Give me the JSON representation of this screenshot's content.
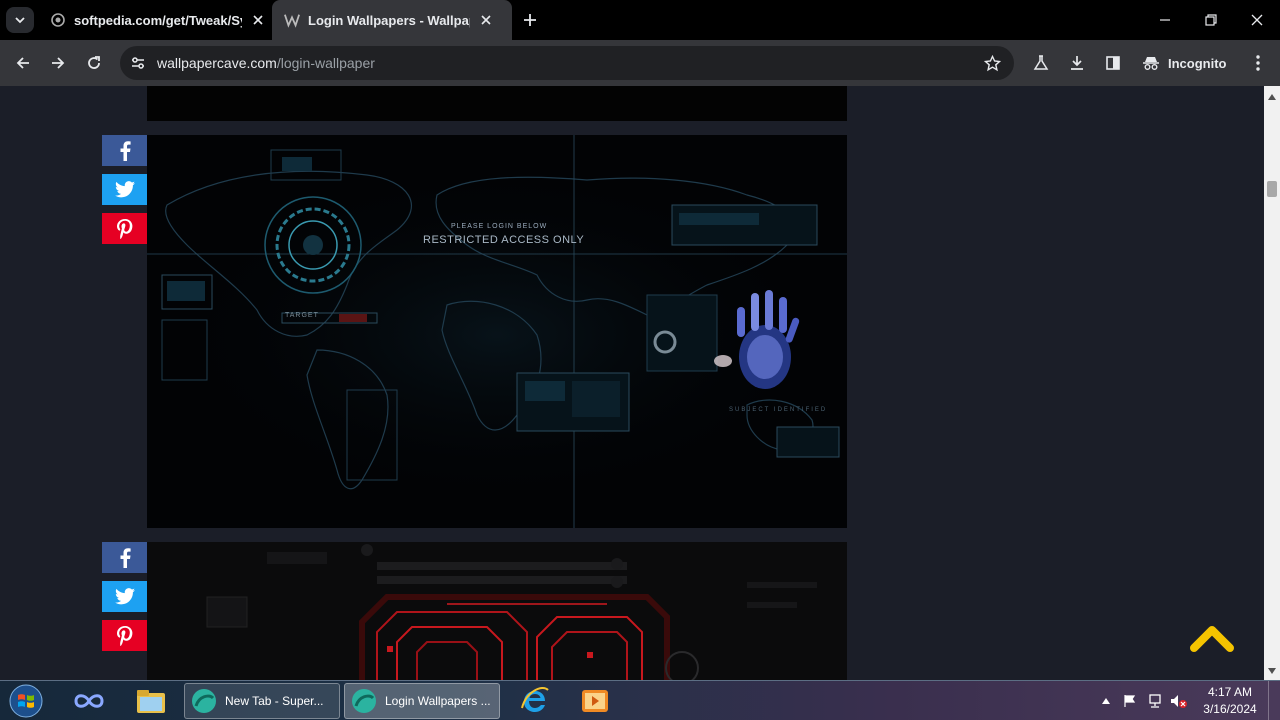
{
  "browser": {
    "tabs": [
      {
        "title": "softpedia.com/get/Tweak/Syst",
        "icon": "softpedia-icon"
      },
      {
        "title": "Login Wallpapers - Wallpaper",
        "icon": "wallpapercave-icon"
      }
    ],
    "url_domain": "wallpapercave.com",
    "url_path": "/login-wallpaper",
    "incognito_label": "Incognito"
  },
  "page": {
    "wallpaper1": {
      "line1": "PLEASE LOGIN BELOW",
      "line2": "RESTRICTED ACCESS ONLY",
      "target_label": "TARGET",
      "subject_label": "SUBJECT IDENTIFIED"
    },
    "share_buttons": [
      "facebook-icon",
      "twitter-icon",
      "pinterest-icon"
    ],
    "back_to_top_color": "#f5c400"
  },
  "taskbar": {
    "tasks": [
      {
        "label": "New Tab - Super..."
      },
      {
        "label": "Login Wallpapers ..."
      }
    ],
    "time": "4:17 AM",
    "date": "3/16/2024"
  }
}
